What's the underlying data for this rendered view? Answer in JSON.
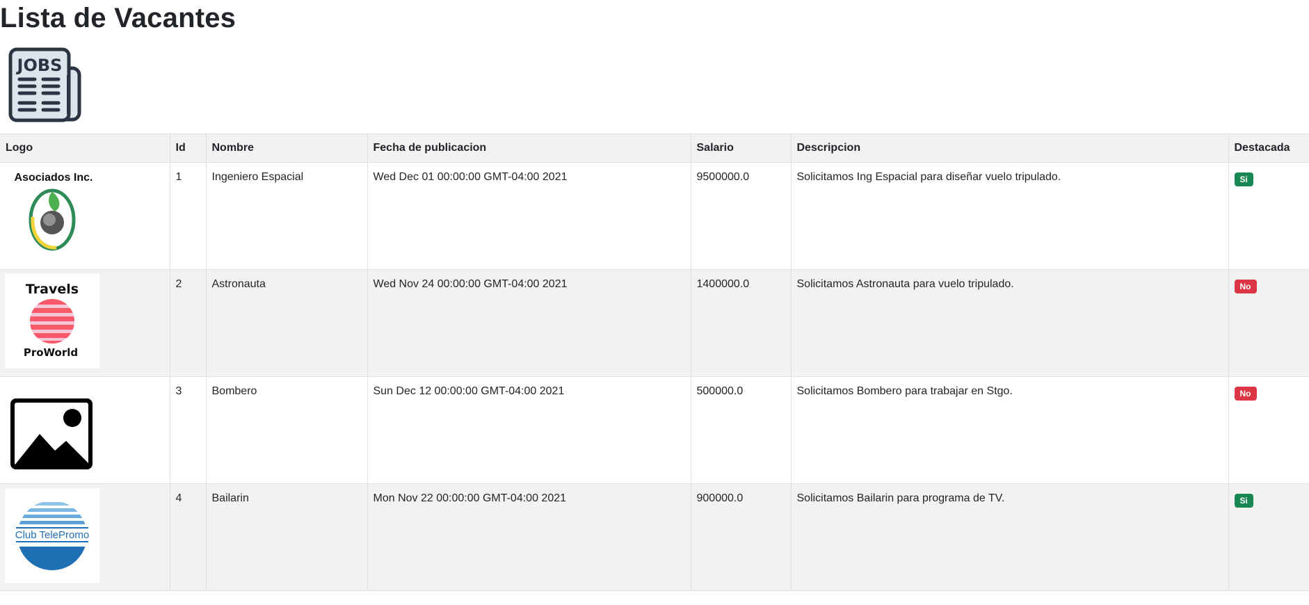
{
  "page": {
    "title": "Lista de Vacantes"
  },
  "header_icon": {
    "text": "JOBS",
    "name": "jobs-newspaper-icon"
  },
  "table": {
    "columns": [
      "Logo",
      "Id",
      "Nombre",
      "Fecha de publicacion",
      "Salario",
      "Descripcion",
      "Destacada"
    ],
    "rows": [
      {
        "logo": {
          "name": "asociados-logo",
          "text": "Asociados Inc."
        },
        "id": "1",
        "nombre": "Ingeniero Espacial",
        "fecha": "Wed Dec 01 00:00:00 GMT-04:00 2021",
        "salario": "9500000.0",
        "descripcion": "Solicitamos Ing Espacial para diseñar vuelo tripulado.",
        "destacada": "Si"
      },
      {
        "logo": {
          "name": "travels-proworld-logo",
          "text_top": "Travels",
          "text_bottom": "ProWorld"
        },
        "id": "2",
        "nombre": "Astronauta",
        "fecha": "Wed Nov 24 00:00:00 GMT-04:00 2021",
        "salario": "1400000.0",
        "descripcion": "Solicitamos Astronauta para vuelo tripulado.",
        "destacada": "No"
      },
      {
        "logo": {
          "name": "image-placeholder-icon"
        },
        "id": "3",
        "nombre": "Bombero",
        "fecha": "Sun Dec 12 00:00:00 GMT-04:00 2021",
        "salario": "500000.0",
        "descripcion": "Solicitamos Bombero para trabajar en Stgo.",
        "destacada": "No"
      },
      {
        "logo": {
          "name": "club-telepromo-logo",
          "text": "Club TelePromo"
        },
        "id": "4",
        "nombre": "Bailarin",
        "fecha": "Mon Nov 22 00:00:00 GMT-04:00 2021",
        "salario": "900000.0",
        "descripcion": "Solicitamos Bailarin para programa de TV.",
        "destacada": "Si"
      }
    ]
  },
  "colors": {
    "badge_si": "#198754",
    "badge_no": "#dc3545",
    "row_stripe": "#f2f2f2",
    "border": "#dee2e6",
    "icon_dark": "#2b3443",
    "icon_light": "#dde4ec"
  }
}
